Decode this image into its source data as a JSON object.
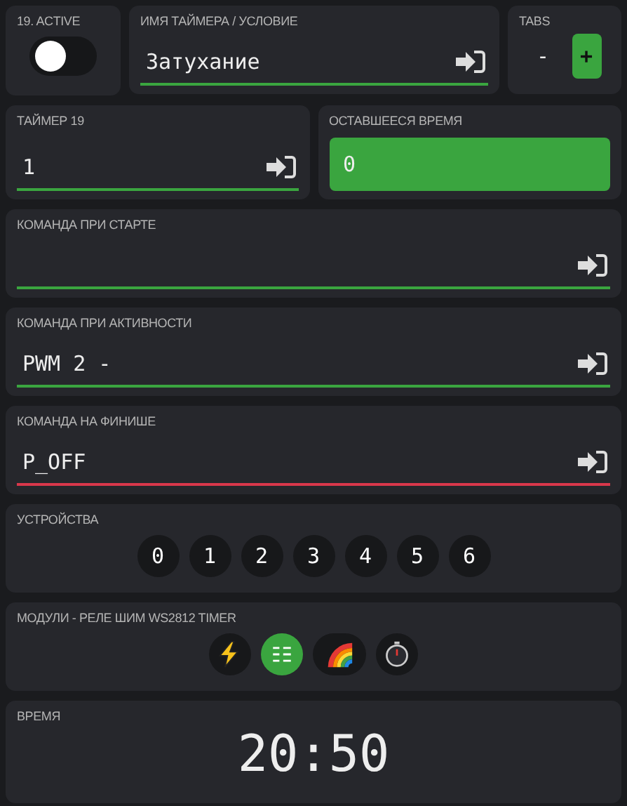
{
  "active": {
    "label": "19. ACTIVE",
    "on": false
  },
  "name_field": {
    "label": "ИМЯ ТАЙМЕРА / УСЛОВИЕ",
    "value": "Затухание",
    "color": "#3aa53f"
  },
  "tabs": {
    "label": "TABS",
    "minus": "-",
    "plus": "+"
  },
  "timer_field": {
    "label": "ТАЙМЕР 19",
    "value": "1",
    "color": "#3aa53f"
  },
  "remaining": {
    "label": "ОСТАВШЕЕСЯ ВРЕМЯ",
    "value": "0"
  },
  "commands": [
    {
      "label": "КОМАНДА ПРИ СТАРТЕ",
      "color": "#3aa53f"
    },
    {
      "label": "КОМАНДА ПРИ АКТИВНОСТИ",
      "value": "PWM 2 -",
      "color": "#3aa53f"
    },
    {
      "label": "КОМАНДА НА ФИНИШЕ",
      "value": "P_OFF",
      "color": "#d9374b"
    }
  ],
  "devices": {
    "label": "УСТРОЙСТВА",
    "items": [
      {
        "label": "0",
        "selected": false
      },
      {
        "label": "1",
        "selected": false
      },
      {
        "label": "2",
        "selected": false
      },
      {
        "label": "3",
        "selected": false
      },
      {
        "label": "4",
        "selected": false
      },
      {
        "label": "5",
        "selected": false
      },
      {
        "label": "6",
        "selected": false
      }
    ]
  },
  "modules": {
    "label": "МОДУЛИ - РЕЛЕ ШИМ WS2812 TIMER",
    "items": [
      {
        "kind": "relay",
        "selected": false
      },
      {
        "kind": "pwm",
        "selected": true
      },
      {
        "kind": "ws2812",
        "selected": false
      },
      {
        "kind": "timer",
        "selected": false
      }
    ]
  },
  "time": {
    "label": "ВРЕМЯ",
    "value": "20:50"
  }
}
